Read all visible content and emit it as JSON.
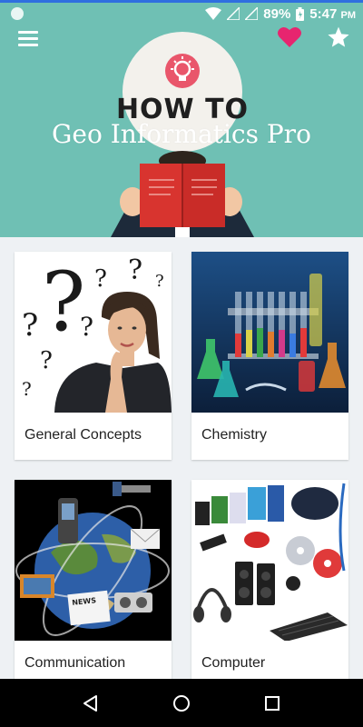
{
  "status_bar": {
    "battery": "89%",
    "time": "5:47",
    "ampm": "PM",
    "icons": [
      "wifi-icon",
      "signal-icon",
      "battery-icon"
    ]
  },
  "header": {
    "title": "Geo Informatics Pro",
    "illustration_text": "HOW TO",
    "menu_icon": "hamburger-menu-icon",
    "favorite_icon": "heart-icon",
    "rate_icon": "star-icon"
  },
  "categories": [
    {
      "label": "General Concepts",
      "image": "woman-thinking-question-marks"
    },
    {
      "label": "Chemistry",
      "image": "chemistry-flasks-tubes"
    },
    {
      "label": "Communication",
      "image": "globe-communication-devices"
    },
    {
      "label": "Computer",
      "image": "computer-peripherals"
    }
  ],
  "nav_bar": {
    "icons": [
      "back-icon",
      "home-icon",
      "recents-icon"
    ]
  },
  "colors": {
    "header_teal": "#6fc0b4",
    "heart_pink": "#e7256f",
    "background": "#eef1f4",
    "book_red": "#d8342f"
  }
}
